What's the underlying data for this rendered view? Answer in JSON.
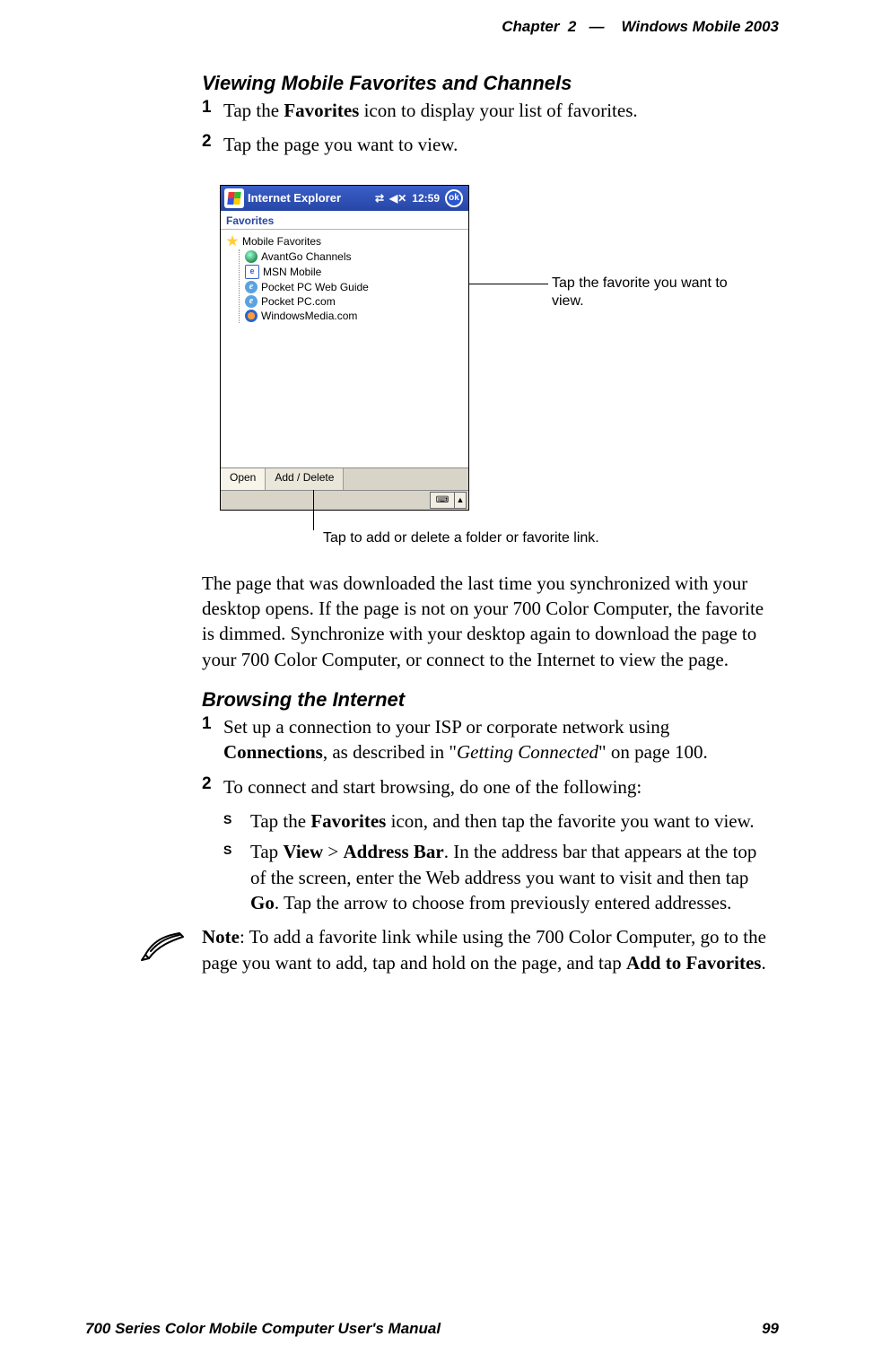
{
  "header": {
    "chapter_label": "Chapter",
    "chapter_num": "2",
    "em_dash": "—",
    "title": "Windows Mobile 2003"
  },
  "sections": {
    "viewing": {
      "heading": "Viewing Mobile Favorites and Channels",
      "step1_num": "1",
      "step1_a": "Tap the ",
      "step1_b": "Favorites",
      "step1_c": " icon to display your list of favorites.",
      "step2_num": "2",
      "step2": "Tap the page you want to view.",
      "after_para": "The page that was downloaded the last time you synchronized with your desktop opens. If the page is not on your 700 Color Computer, the favorite is dimmed. Synchronize with your desktop again to download the page to your 700 Color Computer, or connect to the Internet to view the page."
    },
    "browsing": {
      "heading": "Browsing the Internet",
      "step1_num": "1",
      "step1_a": "Set up a connection to your ISP or corporate network using ",
      "step1_b": "Connections",
      "step1_c": ", as described in \"",
      "step1_d": "Getting Connected",
      "step1_e": "\" on page 100.",
      "step2_num": "2",
      "step2": "To connect and start browsing, do one of the following:",
      "bullet_char": "S",
      "b1_a": "Tap the ",
      "b1_b": "Favorites",
      "b1_c": " icon, and then tap the favorite you want to view.",
      "b2_a": "Tap ",
      "b2_b": "View",
      "b2_c": " > ",
      "b2_d": "Address Bar",
      "b2_e": ". In the address bar that appears at the top of the screen, enter the Web address you want to visit and then tap ",
      "b2_f": "Go",
      "b2_g": ". Tap the arrow to choose from previously entered addresses."
    },
    "note": {
      "label": "Note",
      "a": ": To add a favorite link while using the 700 Color Computer, go to the page you want to add, tap and hold on the page, and tap ",
      "b": "Add to Favorites",
      "c": "."
    }
  },
  "screenshot": {
    "title": "Internet Explorer",
    "time": "12:59",
    "ok": "ok",
    "fav_label": "Favorites",
    "tree_root": "Mobile Favorites",
    "items": {
      "avantgo": "AvantGo Channels",
      "msn": "MSN Mobile",
      "guide": "Pocket PC Web Guide",
      "ppccom": "Pocket PC.com",
      "wmp": "WindowsMedia.com"
    },
    "tab_open": "Open",
    "tab_add": "Add / Delete",
    "sip": "⌨",
    "sip_arrow": "▲"
  },
  "callouts": {
    "right": "Tap the favorite you want to view.",
    "bottom": "Tap to add or delete a folder or favorite link."
  },
  "footer": {
    "manual": "700 Series Color Mobile Computer User's Manual",
    "page": "99"
  }
}
